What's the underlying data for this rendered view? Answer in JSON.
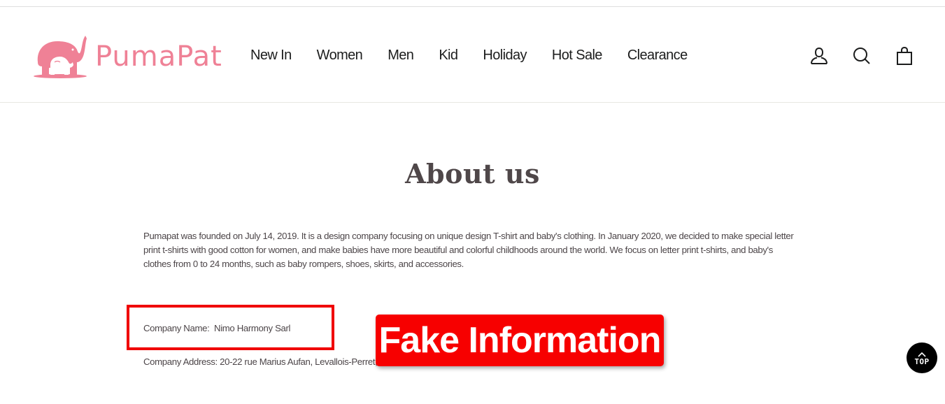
{
  "header": {
    "logo_text": "PumaPat",
    "brand_color": "#ef8196",
    "nav": [
      {
        "label": "New In"
      },
      {
        "label": "Women"
      },
      {
        "label": "Men"
      },
      {
        "label": "Kid"
      },
      {
        "label": "Holiday"
      },
      {
        "label": "Hot Sale"
      },
      {
        "label": "Clearance"
      }
    ],
    "icons": [
      "account-icon",
      "search-icon",
      "cart-icon"
    ]
  },
  "main": {
    "title": "About us",
    "about_text": "Pumapat was founded on July 14, 2019. It is a design company focusing on unique design T-shirt and baby's clothing. In January 2020, we decided to make special letter print t-shirts with good cotton for women, and make babies have more beautiful and colorful childhoods around the world. We focus on letter print t-shirts, and baby's clothes from 0 to 24 months, such as baby rompers, shoes, skirts, and accessories.",
    "company_name": "Company Name:  Nimo Harmony Sarl",
    "company_address": "Company Address: 20-22 rue Marius Aufan, Levallois-Perret, 923"
  },
  "annotation": {
    "label": "Fake Information",
    "color": "#f70000"
  },
  "back_to_top": {
    "label": "TOP"
  }
}
